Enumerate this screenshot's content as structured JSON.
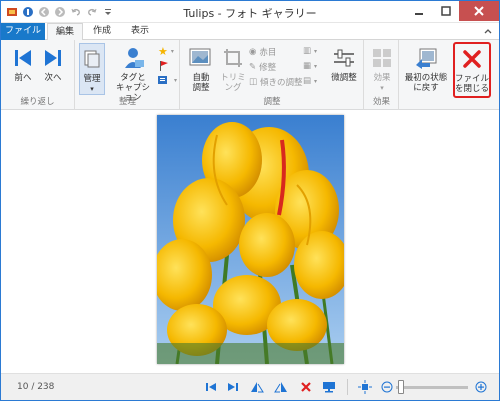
{
  "window": {
    "title": "Tulips - フォト ギャラリー"
  },
  "tabs": [
    "ファイル",
    "編集",
    "作成",
    "表示"
  ],
  "ribbon": {
    "groups": {
      "repeat": "繰り返し",
      "organize": "整理",
      "adjust": "調整",
      "effect": "効果"
    },
    "prev": "前へ",
    "next": "次へ",
    "manage": "管理",
    "tags": "タグと キャプション",
    "auto_adjust": "自動 調整",
    "trim": "トリミ ング",
    "redeye": "赤目",
    "retouch": "修整",
    "straighten": "傾きの調整",
    "fine_tune": "微調整",
    "effect_btn": "効果",
    "revert": "最初の状態 に戻す",
    "close_file": "ファイル を閉じる"
  },
  "status": {
    "counter": "10 / 238"
  },
  "colors": {
    "accent": "#1979ca",
    "close_red": "#e02020"
  }
}
